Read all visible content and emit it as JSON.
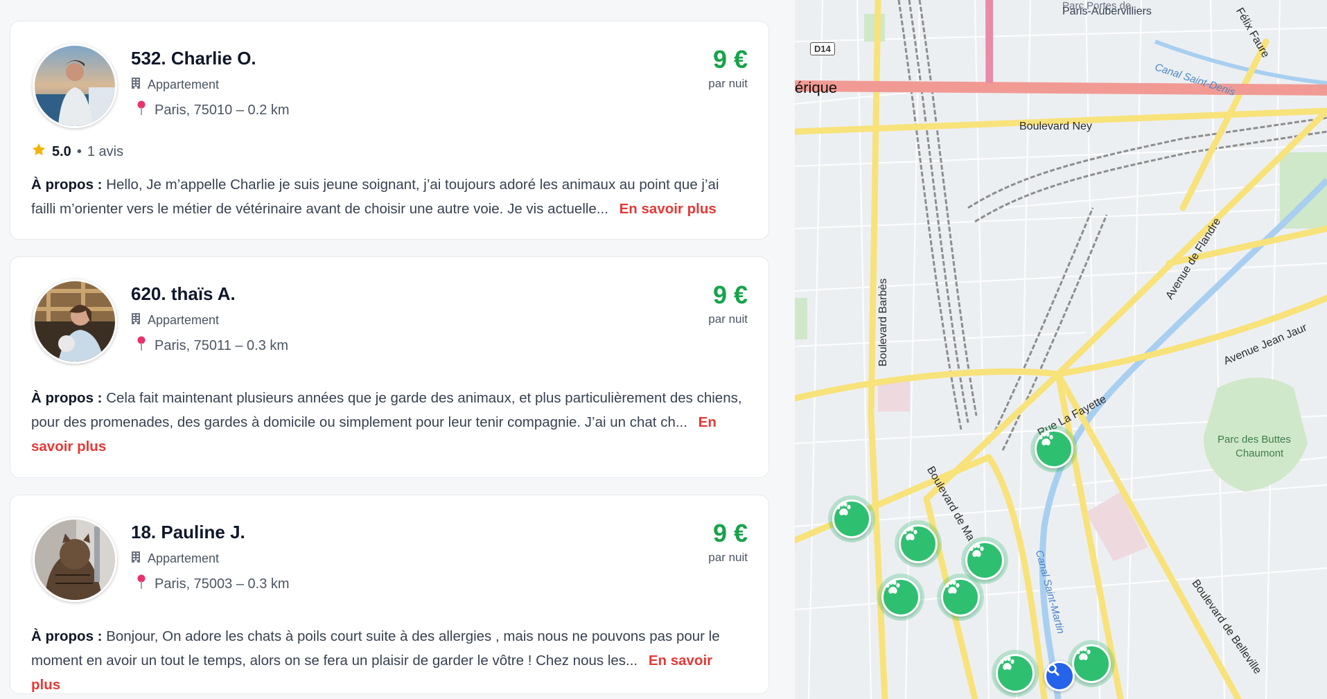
{
  "listings": [
    {
      "name": "532. Charlie O.",
      "type": "Appartement",
      "location": "Paris, 75010 – 0.2 km",
      "price": "9 €",
      "price_unit": "par nuit",
      "rating": {
        "score": "5.0",
        "separator": "•",
        "reviews": "1 avis"
      },
      "about_label": "À propos :",
      "about_text": "Hello, Je m’appelle Charlie je suis jeune soignant, j’ai toujours adoré les animaux au point que j’ai failli m’orienter vers le métier de vétérinaire avant de choisir une autre voie. Je vis actuelle...",
      "more_label": "En savoir plus"
    },
    {
      "name": "620. thaïs A.",
      "type": "Appartement",
      "location": "Paris, 75011 – 0.3 km",
      "price": "9 €",
      "price_unit": "par nuit",
      "about_label": "À propos :",
      "about_text": "Cela fait maintenant plusieurs années que je garde des animaux, et plus particulièrement des chiens, pour des promenades, des gardes à domicile ou simplement pour leur tenir compagnie. J’ai un chat ch...",
      "more_label": "En savoir plus"
    },
    {
      "name": "18. Pauline J.",
      "type": "Appartement",
      "location": "Paris, 75003 – 0.3 km",
      "price": "9 €",
      "price_unit": "par nuit",
      "about_label": "À propos :",
      "about_text": "Bonjour, On adore les chats à poils court suite à des allergies , mais nous ne pouvons pas pour le moment en avoir un tout le temps, alors on se fera un plaisir de garder le vôtre ! Chez nous les...",
      "more_label": "En savoir plus"
    }
  ],
  "map": {
    "labels": {
      "top_area": "Paris-Aubervilliers",
      "top_area_partial": "Parc Portes de",
      "amerique": "érique",
      "d14": "D14",
      "blvd_ney": "Boulevard Ney",
      "felix_faure": "Félix Faure",
      "canal_st_denis": "Canal Saint-Denis",
      "ave_flandre": "Avenue de Flandre",
      "ave_jean_jaures": "Avenue Jean Jaur",
      "blvd_barbes": "Boulevard Barbès",
      "rue_la_fayette": "Rue La Fayette",
      "parc_buttes_1": "Parc des Buttes",
      "parc_buttes_2": "Chaumont",
      "blvd_magenta": "Boulevard de Ma",
      "canal_st_martin": "Canal Saint-Martin",
      "blvd_belleville": "Boulevard de Belleville"
    },
    "colors": {
      "marker": "#2fbf71",
      "search_marker": "#2563eb",
      "price": "#16a34a",
      "link": "#e53935"
    },
    "marker_icon": "paw-icon",
    "search_icon": "search-icon"
  }
}
